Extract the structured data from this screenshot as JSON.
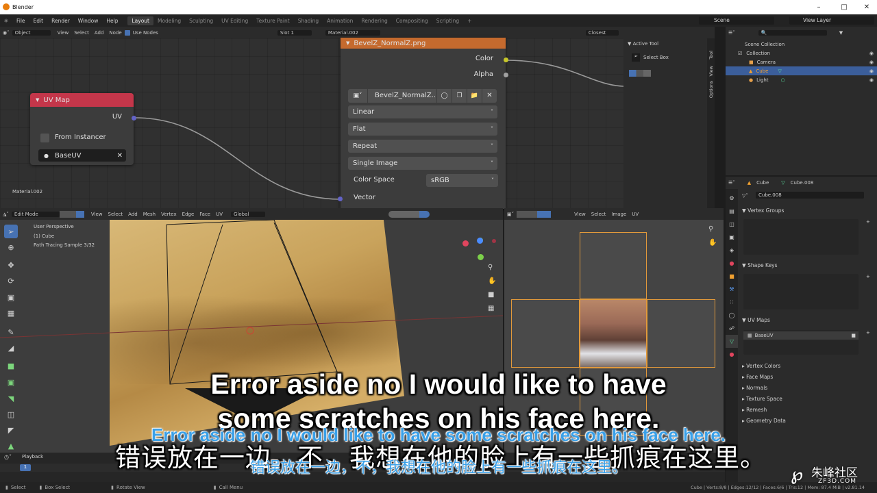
{
  "window": {
    "title": "Blender"
  },
  "menu": {
    "items": [
      "File",
      "Edit",
      "Render",
      "Window",
      "Help"
    ],
    "workspaces": [
      "Layout",
      "Modeling",
      "Sculpting",
      "UV Editing",
      "Texture Paint",
      "Shading",
      "Animation",
      "Rendering",
      "Compositing",
      "Scripting"
    ],
    "active_workspace": "Layout",
    "scene": "Scene",
    "view_layer": "View Layer"
  },
  "node_header": {
    "mode": "Object",
    "view": "View",
    "select": "Select",
    "add": "Add",
    "node": "Node",
    "use_nodes": "Use Nodes",
    "slot": "Slot 1",
    "material": "Material.002",
    "closest": "Closest"
  },
  "node_editor": {
    "material_label": "Material.002",
    "uv_node": {
      "title": "UV Map",
      "output": "UV",
      "from_instancer": "From Instancer",
      "uv_map": "BaseUV"
    },
    "image_node": {
      "title": "BevelZ_NormalZ.png",
      "output_color": "Color",
      "output_alpha": "Alpha",
      "image_name": "BevelZ_NormalZ...",
      "interpolation": "Linear",
      "projection": "Flat",
      "extension": "Repeat",
      "source": "Single Image",
      "color_space_label": "Color Space",
      "color_space_value": "sRGB",
      "input_vector": "Vector"
    }
  },
  "n_panel": {
    "section": "Active Tool",
    "tool": "Select Box",
    "tabs": [
      "Tool",
      "View",
      "Options"
    ]
  },
  "outliner": {
    "rows": [
      {
        "label": "Scene Collection",
        "color": "#cfcfcf"
      },
      {
        "label": "Collection",
        "color": "#cfcfcf"
      },
      {
        "label": "Camera",
        "color": "#cfcfcf"
      },
      {
        "label": "Cube",
        "color": "#f0a030"
      },
      {
        "label": "Light",
        "color": "#cfcfcf"
      }
    ]
  },
  "viewport_header": {
    "mode": "Edit Mode",
    "menus": [
      "View",
      "Select",
      "Add",
      "Mesh",
      "Vertex",
      "Edge",
      "Face",
      "UV"
    ],
    "orientation": "Global"
  },
  "viewport": {
    "info": [
      "User Perspective",
      "(1) Cube",
      "Path Tracing Sample 3/32"
    ]
  },
  "uv_header": {
    "menus": [
      "View",
      "Select",
      "Image",
      "UV"
    ]
  },
  "properties": {
    "object": "Cube",
    "mesh": "Cube.008",
    "mesh_field": "Cube.008",
    "sections_top": [
      "Vertex Groups",
      "Shape Keys",
      "UV Maps"
    ],
    "uv_map_item": "BaseUV",
    "sections_collapsed": [
      "Vertex Colors",
      "Face Maps",
      "Normals",
      "Texture Space",
      "Remesh",
      "Geometry Data"
    ]
  },
  "timeline": {
    "playback": "Playback",
    "frame": "1"
  },
  "status": {
    "select": "Select",
    "box_select": "Box Select",
    "rotate_view": "Rotate View",
    "call_menu": "Call Menu",
    "stats": "Cube | Verts:8/8 | Edges:12/12 | Faces:6/6 | Tris:12 | Mem: 87.4 MiB | v2.81.14"
  },
  "subtitles": {
    "en_line1": "Error aside no I would like to have",
    "en_line2": "some scratches on his face here.",
    "en_small": "Error aside no I would like to have some scratches on his face here.",
    "zh_large": "错误放在一边，不，我想在他的脸上有一些抓痕在这里。",
    "zh_small": "错误放在一边，不，我想在他的脸上有一些抓痕在这里。"
  },
  "watermark": {
    "brand": "朱峰社区",
    "url": "ZF3D.COM"
  },
  "colors": {
    "uv_node_header": "#c4364a",
    "image_node_header": "#c56a2e",
    "selection": "#3b5e9b",
    "uv_socket": "#6363c7",
    "color_socket": "#c7c729",
    "gray_socket": "#a1a1a1",
    "uv_island": "#e39a3b"
  }
}
